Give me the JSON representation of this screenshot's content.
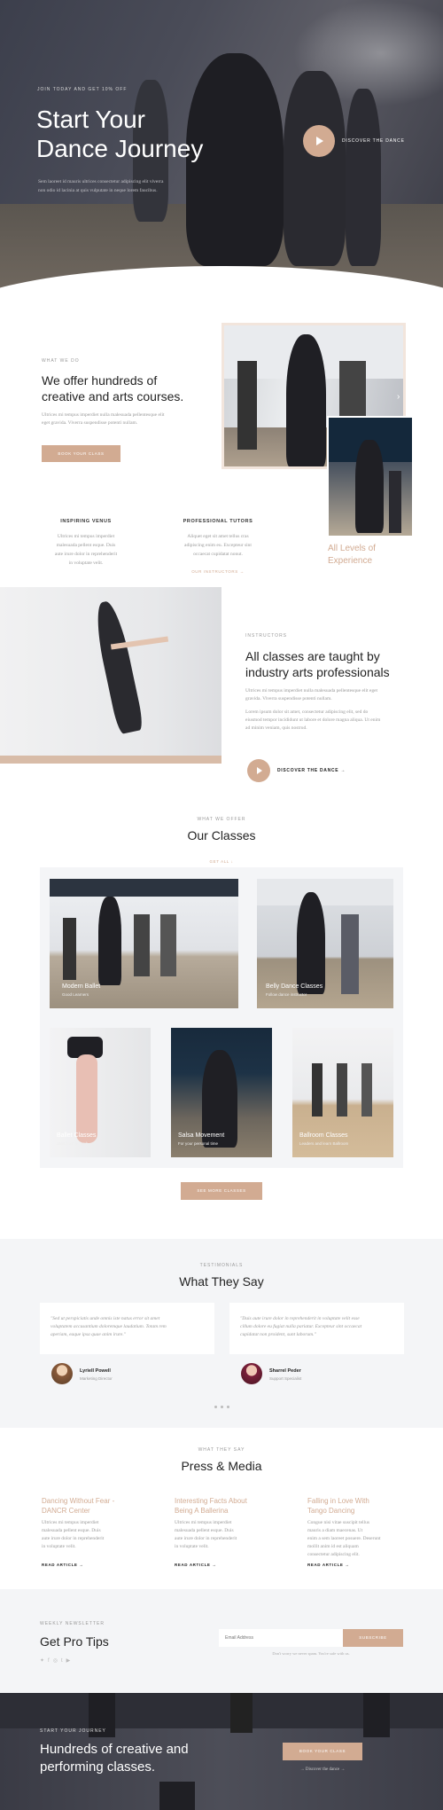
{
  "hero": {
    "kicker": "JOIN TODAY AND GET 10% OFF",
    "title_line1": "Start Your",
    "title_line2": "Dance Journey",
    "text_line1": "Sem laoreet id mauris ultrices consectetur adipiscing elit viverra",
    "text_line2": "non odio id lacinia at quis vulputate in neque lorem faucibus.",
    "cta_label": "DISCOVER THE DANCE"
  },
  "about": {
    "kicker": "WHAT WE DO",
    "title_line1": "We offer hundreds of",
    "title_line2": "creative and arts courses.",
    "text_line1": "Ultrices mi tempus imperdiet nulla malesuada pellentesque elit",
    "text_line2": "eget gravida. Viverra suspendisse potenti nullam.",
    "button": "BOOK YOUR CLASS",
    "feature1_title": "INSPIRING VENUS",
    "feature1_text": [
      "Ultrices mi tempus imperdiet",
      "malesuada pellent esque. Duis",
      "aute irure dolor in reprehenderit",
      "in voluptate velit."
    ],
    "feature2_title": "PROFESSIONAL TUTORS",
    "feature2_text": [
      "Aliquet eget sit amet tellus cras",
      "adipiscing enim eu. Excepteur sint",
      "occaecat cupidatat nonut."
    ],
    "feature2_link": "OUR INSTRUCTORS →",
    "levels_line1": "All Levels of",
    "levels_line2": "Experience"
  },
  "instructors": {
    "kicker": "INSTRUCTORS",
    "title_line1": "All classes are taught by",
    "title_line2": "industry arts professionals",
    "text1_line1": "Ultrices mi tempus imperdiet nulla malesuada pellentesque elit eget",
    "text1_line2": "gravida. Viverra suspendisse potenti nullam.",
    "text2_line1": "Lorem ipsum dolor sit amet, consectetur adipiscing elit, sed do",
    "text2_line2": "eiusmod tempor incididunt ut labore et dolore magna aliqua. Ut enim",
    "text2_line3": "ad minim veniam, quis nostrud.",
    "cta_label": "DISCOVER THE DANCE →"
  },
  "classes": {
    "kicker": "WHAT WE OFFER",
    "title": "Our Classes",
    "filter": "GET ALL ↓",
    "items": [
      {
        "name": "Modern Ballet",
        "sub": "Good Learners"
      },
      {
        "name": "Belly Dance Classes",
        "sub": "Follow dance instructor"
      },
      {
        "name": "Ballet Classes",
        "sub": "Start from scratch"
      },
      {
        "name": "Salsa Movement",
        "sub": "For your personal time"
      },
      {
        "name": "Ballroom Classes",
        "sub": "Leaders and learn Ballroom"
      }
    ],
    "button": "SEE MORE CLASSES"
  },
  "testimonials": {
    "kicker": "TESTIMONIALS",
    "title": "What They Say",
    "items": [
      {
        "quote_line1": "\"Sed ut perspiciatis unde omnis iste natus error sit amet",
        "quote_line2": "voluptatem accusantium doloremque laudatium. Totam rem",
        "quote_line3": "aperiam, eaque ipsa quae anim irure.\"",
        "name": "Lyriell Powell",
        "role": "Marketing Director"
      },
      {
        "quote_line1": "\"Duis aute irure dolor in reprehenderit in voluptate velit esse",
        "quote_line2": "cillum dolore eu fugiat nulla pariatur. Excepteur sint occaecat",
        "quote_line3": "cupidatat non proident, sunt laborum.\"",
        "name": "Sharrel Peder",
        "role": "Support Specialist"
      }
    ]
  },
  "press": {
    "kicker": "WHAT THEY SAY",
    "title": "Press & Media",
    "items": [
      {
        "title_line1": "Dancing Without Fear -",
        "title_line2": "DANCR Center",
        "text": [
          "Ultrices mi tempus imperdiet",
          "malesuada pellent esque. Duis",
          "aute irure dolor in reprehenderit",
          "in voluptate velit."
        ],
        "link": "READ ARTICLE →"
      },
      {
        "title_line1": "Interesting Facts About",
        "title_line2": "Being A Ballerina",
        "text": [
          "Ultrices mi tempus imperdiet",
          "malesuada pellent esque. Duis",
          "aute irure dolor in reprehenderit",
          "in voluptate velit."
        ],
        "link": "READ ARTICLE →"
      },
      {
        "title_line1": "Falling in Love With",
        "title_line2": "Tango Dancing",
        "text": [
          "Congue nisi vitae suscipit tellus",
          "mauris a diam maecenas. Ut",
          "enim a sem laoreet posuere. Deserunt",
          "mollit anim id est aliquam",
          "consectetur adipiscing elit."
        ],
        "link": "READ ARTICLE →"
      }
    ]
  },
  "newsletter": {
    "kicker": "WEEKLY NEWSLETTER",
    "title": "Get Pro Tips",
    "placeholder": "Email Address",
    "button": "SUBSCRIBE",
    "note": "Don't worry we never spam. You're safe with us.",
    "social_icons": [
      "twitter-icon",
      "facebook-icon",
      "instagram-icon",
      "tumblr-icon",
      "youtube-icon"
    ]
  },
  "footer_cta": {
    "kicker": "START YOUR JOURNEY",
    "title_line1": "Hundreds of creative and",
    "title_line2": "performing classes.",
    "button": "BOOK YOUR CLASS",
    "link": "→ Discover the dance →"
  },
  "colors": {
    "accent": "#d2ab92",
    "dark": "#3f404c",
    "light_bg": "#f4f5f7"
  }
}
